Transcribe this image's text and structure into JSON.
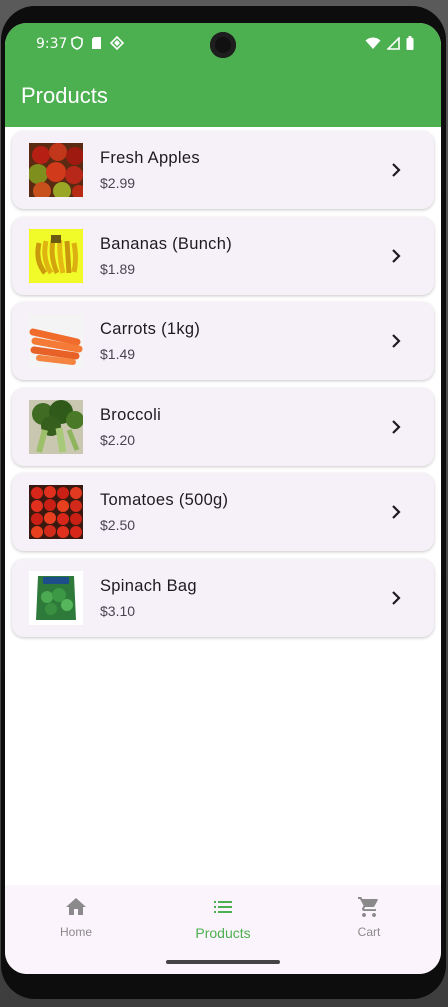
{
  "status_bar": {
    "time": "9:37",
    "left_icons": [
      "shield-icon",
      "sd-card-icon",
      "data-saver-icon"
    ],
    "right_icons": [
      "wifi-icon",
      "signal-icon",
      "battery-icon"
    ]
  },
  "app_bar": {
    "title": "Products",
    "color": "#4caf50"
  },
  "products": [
    {
      "name": "Fresh Apples",
      "price": "$2.99",
      "image": "apples"
    },
    {
      "name": "Bananas (Bunch)",
      "price": "$1.89",
      "image": "bananas"
    },
    {
      "name": "Carrots (1kg)",
      "price": "$1.49",
      "image": "carrots"
    },
    {
      "name": "Broccoli",
      "price": "$2.20",
      "image": "broccoli"
    },
    {
      "name": "Tomatoes (500g)",
      "price": "$2.50",
      "image": "tomatoes"
    },
    {
      "name": "Spinach Bag",
      "price": "$3.10",
      "image": "spinach"
    }
  ],
  "bottom_nav": {
    "items": [
      {
        "label": "Home",
        "icon": "home-icon"
      },
      {
        "label": "Products",
        "icon": "list-icon",
        "active": true
      },
      {
        "label": "Cart",
        "icon": "cart-icon"
      }
    ]
  }
}
